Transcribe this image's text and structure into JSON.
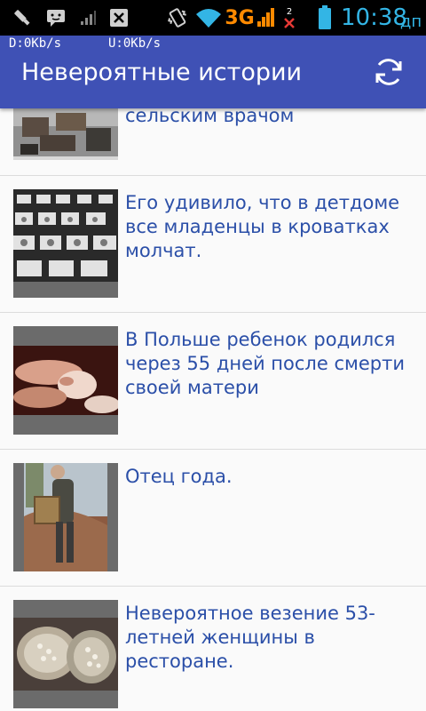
{
  "status_bar": {
    "network": "3G",
    "sim_badge": "2",
    "time": "10:38",
    "period": "дп",
    "icons": [
      "usb-icon",
      "messenger-icon",
      "signal-icon",
      "image-icon",
      "vibrate-icon",
      "wifi-icon",
      "signal-3g-icon",
      "missed-call-icon",
      "battery-icon"
    ]
  },
  "net_speed": {
    "down": "D:0Kb/s",
    "up": "U:0Kb/s"
  },
  "app_bar": {
    "title": "Невероятные истории",
    "refresh_icon": "refresh-icon"
  },
  "colors": {
    "primary": "#3f51b5",
    "link_text": "#2b4fa8",
    "status_bar": "#000000",
    "thumb_bg": "#6b6b6b"
  },
  "stories": [
    {
      "title": "сельским врачом",
      "image": "village-market-photo"
    },
    {
      "title": "Его удивило, что в детдоме все младенцы в кроватках молчат.",
      "image": "orphanage-cribs-photo"
    },
    {
      "title": "В Польше ребенок родился через 55 дней после смерти своей матери",
      "image": "baby-hand-photo"
    },
    {
      "title": "Отец года.",
      "image": "man-carrying-basket-photo"
    },
    {
      "title": "Невероятное везение 53-летней женщины в ресторане.",
      "image": "oyster-pearls-photo"
    }
  ]
}
